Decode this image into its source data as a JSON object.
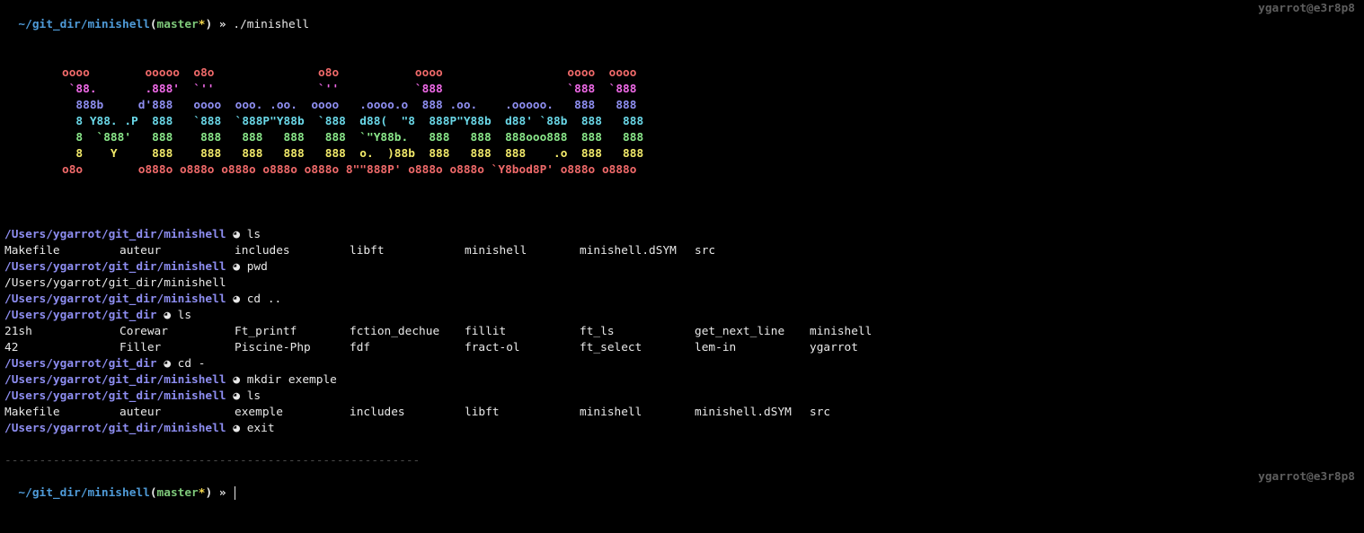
{
  "header": {
    "path": "~/git_dir/minishell",
    "branch": "master",
    "dirty_mark": "*",
    "arrow": "»",
    "command": "./minishell",
    "host": "ygarrot@e3r8p8"
  },
  "banner": {
    "lines": [
      {
        "text": "oooo        ooooo  o8o               o8o           oooo                  oooo  oooo",
        "color": "#f06a6a"
      },
      {
        "text": " `88.       .888'  `''               `''           `888                  `888  `888",
        "color": "#f06ae8"
      },
      {
        "text": "  888b     d'888   oooo  ooo. .oo.  oooo   .oooo.o  888 .oo.    .ooooo.   888   888",
        "color": "#8f8ff2"
      },
      {
        "text": "  8 Y88. .P  888   `888  `888P\"Y88b  `888  d88(  \"8  888P\"Y88b  d88' `88b  888   888",
        "color": "#6ad8e8"
      },
      {
        "text": "  8  `888'   888    888   888   888   888  `\"Y88b.   888   888  888ooo888  888   888",
        "color": "#8ae88a"
      },
      {
        "text": "  8    Y     888    888   888   888   888  o.  )88b  888   888  888    .o  888   888",
        "color": "#f2ea6a"
      },
      {
        "text": "o8o        o888o o888o o888o o888o o888o 8\"\"888P' o888o o888o `Y8bod8P' o888o o888o",
        "color": "#f06a6a"
      }
    ]
  },
  "session": [
    {
      "type": "prompt",
      "path": "/Users/ygarrot/git_dir/minishell",
      "moon": "◕",
      "command": "ls"
    },
    {
      "type": "output",
      "cells": [
        "Makefile",
        "auteur",
        "includes",
        "libft",
        "minishell",
        "minishell.dSYM",
        "src"
      ]
    },
    {
      "type": "prompt",
      "path": "/Users/ygarrot/git_dir/minishell",
      "moon": "◕",
      "command": "pwd"
    },
    {
      "type": "output",
      "cells": [
        "/Users/ygarrot/git_dir/minishell"
      ]
    },
    {
      "type": "prompt",
      "path": "/Users/ygarrot/git_dir/minishell",
      "moon": "◕",
      "command": "cd .."
    },
    {
      "type": "prompt",
      "path": "/Users/ygarrot/git_dir",
      "moon": "◕",
      "command": "ls"
    },
    {
      "type": "output",
      "cells": [
        "21sh",
        "Corewar",
        "Ft_printf",
        "fction_dechue",
        "fillit",
        "ft_ls",
        "get_next_line",
        "minishell"
      ]
    },
    {
      "type": "output",
      "cells": [
        "42",
        "Filler",
        "Piscine-Php",
        "fdf",
        "fract-ol",
        "ft_select",
        "lem-in",
        "ygarrot"
      ]
    },
    {
      "type": "prompt",
      "path": "/Users/ygarrot/git_dir",
      "moon": "◕",
      "command": "cd -"
    },
    {
      "type": "prompt",
      "path": "/Users/ygarrot/git_dir/minishell",
      "moon": "◕",
      "command": "mkdir exemple"
    },
    {
      "type": "prompt",
      "path": "/Users/ygarrot/git_dir/minishell",
      "moon": "◕",
      "command": "ls"
    },
    {
      "type": "output",
      "cells": [
        "Makefile",
        "auteur",
        "exemple",
        "includes",
        "libft",
        "minishell",
        "minishell.dSYM",
        "src"
      ]
    },
    {
      "type": "prompt",
      "path": "/Users/ygarrot/git_dir/minishell",
      "moon": "◕",
      "command": "exit"
    }
  ],
  "separator": "------------------------------------------------------------",
  "footer": {
    "path": "~/git_dir/minishell",
    "branch": "master",
    "dirty_mark": "*",
    "arrow": "»",
    "command": "",
    "host": "ygarrot@e3r8p8"
  }
}
